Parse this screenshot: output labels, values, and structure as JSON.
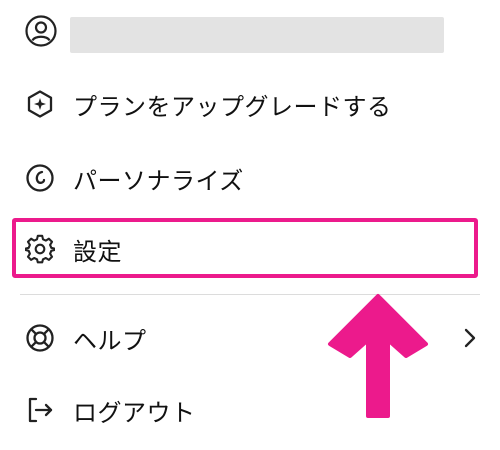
{
  "menu": {
    "user": {
      "avatar_icon": "user-circle-icon",
      "name_redacted": true
    },
    "items": [
      {
        "id": "upgrade",
        "icon": "sparkle-hexagon-icon",
        "label": "プランをアップグレードする"
      },
      {
        "id": "personalize",
        "icon": "personalize-icon",
        "label": "パーソナライズ"
      },
      {
        "id": "settings",
        "icon": "gear-icon",
        "label": "設定"
      },
      {
        "id": "help",
        "icon": "lifebuoy-icon",
        "label": "ヘルプ",
        "has_submenu": true
      },
      {
        "id": "logout",
        "icon": "logout-icon",
        "label": "ログアウト"
      }
    ]
  },
  "annotation": {
    "highlight_color": "#ec1a8c",
    "highlighted_item": "settings",
    "arrow_color": "#ec1a8c"
  }
}
